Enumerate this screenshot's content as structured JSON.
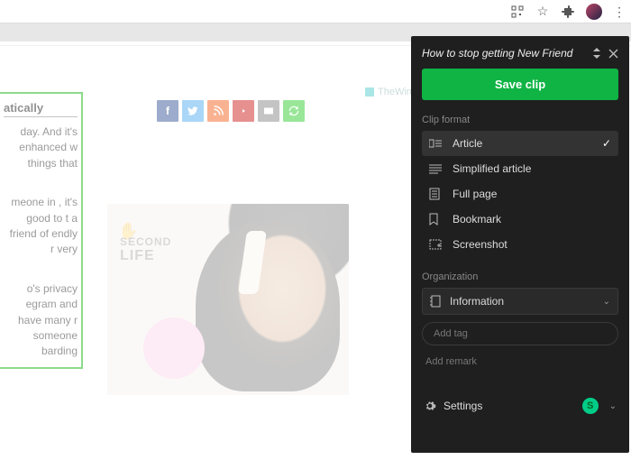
{
  "browser": {
    "icons": [
      "qr-icon",
      "star-icon",
      "puzzle-icon",
      "avatar",
      "more-icon"
    ]
  },
  "page": {
    "watermark": "TheWindowsClub",
    "article": {
      "heading_fragment": "atically",
      "p1": "day. And it's enhanced w things that",
      "p2": "meone in , it's good to t a friend of endly r very",
      "p3": "o's privacy egram and have many r someone barding"
    },
    "social": [
      "f",
      "t",
      "rss",
      "yt",
      "mail",
      "green"
    ],
    "ad": {
      "brand1": "SECOND",
      "brand2": "LIFE",
      "badge": "ⓘ ✕"
    }
  },
  "clipper": {
    "title": "How to stop getting New Friend",
    "save": "Save clip",
    "format_label": "Clip format",
    "formats": [
      {
        "icon": "article-icon",
        "label": "Article",
        "selected": true
      },
      {
        "icon": "simplified-icon",
        "label": "Simplified article",
        "selected": false
      },
      {
        "icon": "fullpage-icon",
        "label": "Full page",
        "selected": false
      },
      {
        "icon": "bookmark-icon",
        "label": "Bookmark",
        "selected": false
      },
      {
        "icon": "screenshot-icon",
        "label": "Screenshot",
        "selected": false
      }
    ],
    "org_label": "Organization",
    "notebook": "Information",
    "tag_placeholder": "Add tag",
    "remark": "Add remark",
    "settings": "Settings",
    "user_initial": "S"
  }
}
